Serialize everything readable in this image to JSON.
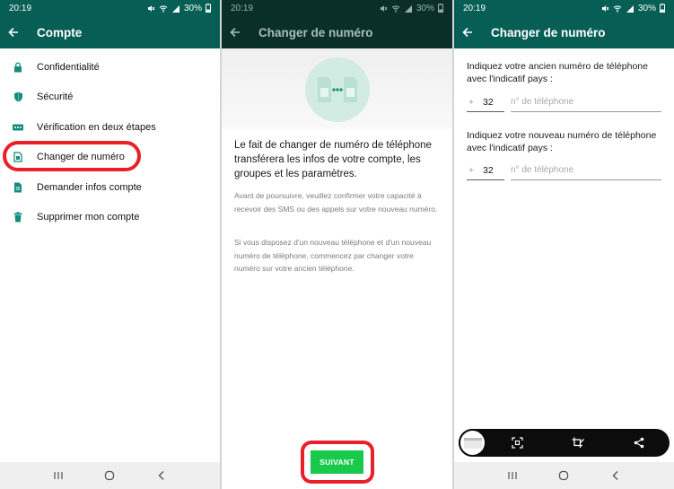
{
  "status_bar": {
    "time_left": "20:19",
    "time_middle": "20:19",
    "time_right": "20:19",
    "battery": "30%"
  },
  "screen_account": {
    "title": "Compte",
    "items": [
      {
        "label": "Confidentialité",
        "icon": "lock-icon"
      },
      {
        "label": "Sécurité",
        "icon": "shield-icon"
      },
      {
        "label": "Vérification en deux étapes",
        "icon": "dots-icon"
      },
      {
        "label": "Changer de numéro",
        "icon": "sim-card-icon"
      },
      {
        "label": "Demander infos compte",
        "icon": "document-icon"
      },
      {
        "label": "Supprimer mon compte",
        "icon": "trash-icon"
      }
    ]
  },
  "screen_change_intro": {
    "title": "Changer de numéro",
    "headline": "Le fait de changer de numéro de téléphone transférera les infos de votre compte, les groupes et les paramètres.",
    "note1": "Avant de poursuivre, veuillez confirmer votre capacité à recevoir des SMS ou des appels sur votre nouveau numéro.",
    "note2": "Si vous disposez d'un nouveau téléphone et d'un nouveau numéro de téléphone, commencez par changer votre numéro sur votre ancien téléphone.",
    "next_button": "SUIVANT"
  },
  "screen_change_form": {
    "title": "Changer de numéro",
    "old_label": "Indiquez votre ancien numéro de téléphone avec l'indicatif pays :",
    "new_label": "Indiquez votre nouveau numéro de téléphone avec l'indicatif pays :",
    "plus": "+",
    "old_country_code": "32",
    "new_country_code": "32",
    "phone_placeholder": "n° de téléphone"
  },
  "colors": {
    "appbar": "#075e54",
    "accent_green": "#18c94c",
    "highlight_red": "#e8202a",
    "icon_teal": "#128c7e"
  }
}
